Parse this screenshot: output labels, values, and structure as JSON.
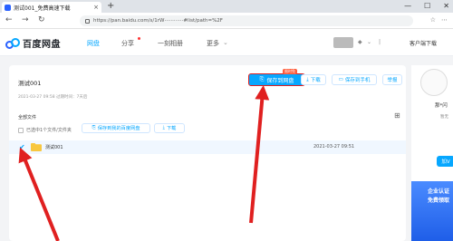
{
  "browser": {
    "tab_title": "测试001_免费高速下载",
    "tab_close": "×",
    "new_tab": "+",
    "window_controls": [
      "—",
      "☐",
      "✕"
    ],
    "nav_back": "←",
    "nav_forward": "→",
    "nav_reload": "↻",
    "url": "https://pan.baidu.com/s/1rW············#list/path=%2F",
    "addr_icons": [
      "☆",
      "⋯"
    ]
  },
  "header": {
    "logo_text": "百度网盘",
    "nav": [
      {
        "label": "网盘",
        "active": true
      },
      {
        "label": "分享",
        "active": false
      },
      {
        "label": "一刻相册",
        "active": false
      },
      {
        "label": "更多",
        "active": false
      }
    ],
    "more_arrow": "⌄",
    "client_download": "客户端下载"
  },
  "share": {
    "title": "测试001",
    "meta": "2021-03-27 09:58   过期时间：7天后",
    "save_label": "保存到网盘",
    "badge": "限时免",
    "download_label": "下载",
    "save_phone_label": "保存到手机",
    "report_label": "举报"
  },
  "files": {
    "all_files_label": "全部文件",
    "selected_label": "已选中1个文件/文件夹",
    "save_to_my_label": "保存到我的百度网盘",
    "download_label": "下载",
    "rows": [
      {
        "name": "测试001",
        "date": "2021-03-27 09:51"
      }
    ]
  },
  "right_panel": {
    "name": "那*闪",
    "sub": "暂无",
    "button_label": "加V",
    "ad_line1": "企业认证",
    "ad_line2": "免费领取"
  },
  "colors": {
    "accent": "#06a7ff",
    "arrow": "#e02020"
  }
}
